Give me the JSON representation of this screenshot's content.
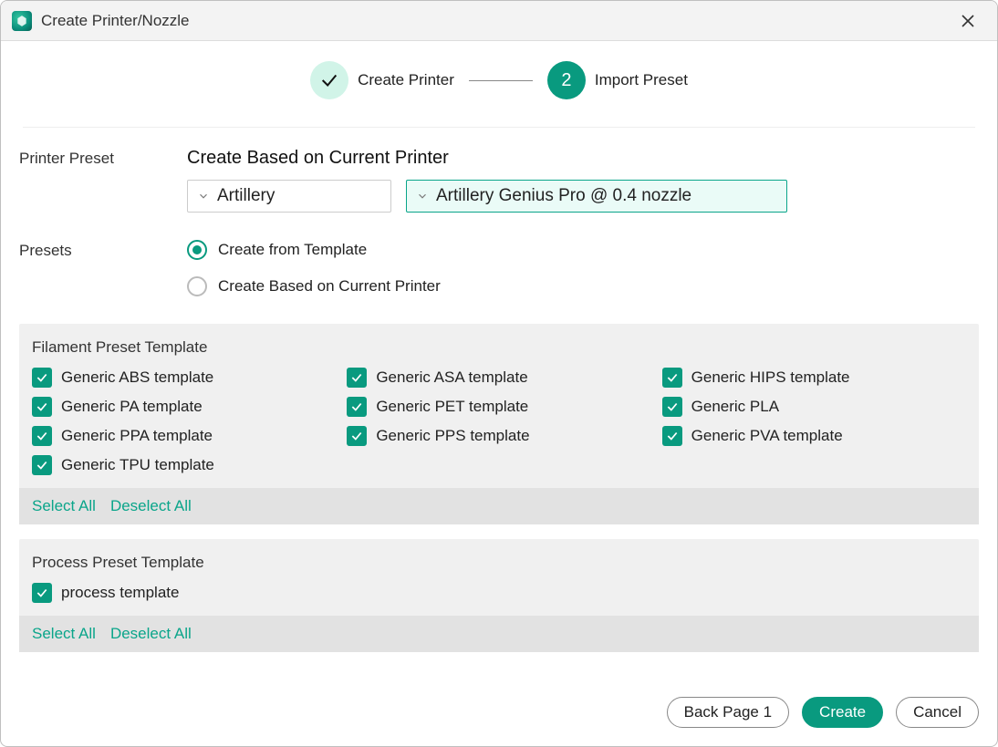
{
  "window": {
    "title": "Create Printer/Nozzle"
  },
  "stepper": {
    "step1": {
      "label": "Create Printer"
    },
    "step2": {
      "number": "2",
      "label": "Import Preset"
    }
  },
  "printer_preset": {
    "row_label": "Printer Preset",
    "heading": "Create Based on Current Printer",
    "brand_select": "Artillery",
    "model_select": "Artillery Genius Pro @ 0.4 nozzle"
  },
  "presets": {
    "row_label": "Presets",
    "option_template": "Create from Template",
    "option_current": "Create Based on Current Printer"
  },
  "filament_panel": {
    "title": "Filament Preset Template",
    "items": [
      "Generic ABS template",
      "Generic ASA template",
      "Generic HIPS template",
      "Generic PA template",
      "Generic PET template",
      "Generic PLA",
      "Generic PPA template",
      "Generic PPS template",
      "Generic PVA template",
      "Generic TPU template"
    ],
    "select_all": "Select All",
    "deselect_all": "Deselect All"
  },
  "process_panel": {
    "title": "Process Preset Template",
    "items": [
      "process template"
    ],
    "select_all": "Select All",
    "deselect_all": "Deselect All"
  },
  "buttons": {
    "back": "Back Page 1",
    "create": "Create",
    "cancel": "Cancel"
  }
}
